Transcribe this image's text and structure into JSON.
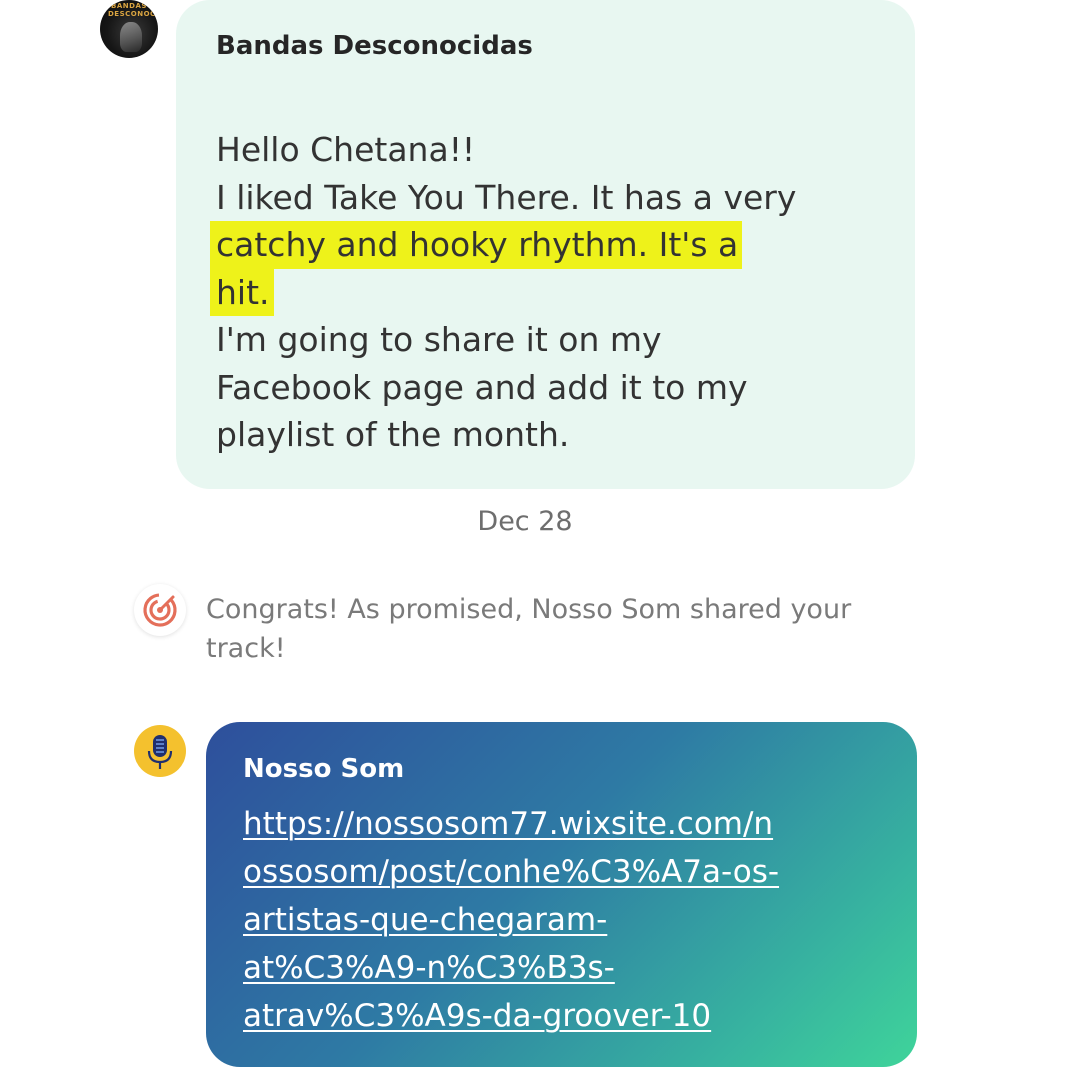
{
  "messages": [
    {
      "sender": "Bandas Desconocidas",
      "avatar_icon": "band-logo-avatar",
      "avatar_text": "BANDAS DESCONOCIDAS",
      "lines": [
        "Hello Chetana!!",
        "I liked Take You There. It has a very",
        "catchy and hooky rhythm. It's a",
        "hit.",
        "I'm going to share it on my",
        "Facebook page and add it to my",
        "playlist of the month."
      ],
      "highlighted_lines": [
        2,
        3
      ],
      "highlight_color": "#eef21a",
      "bubble_color": "#e8f7f1"
    },
    {
      "sender": "Nosso Som",
      "avatar_icon": "microphone-icon",
      "link_lines": [
        "https://nossosom77.wixsite.com/n",
        "ossosom/post/conhe%C3%A7a-os-",
        "artistas-que-chegaram-",
        "at%C3%A9-n%C3%B3s-",
        "atrav%C3%A9s-da-groover-10"
      ],
      "gradient": [
        "#2e4f9c",
        "#3fd49a"
      ]
    }
  ],
  "date_separator": "Dec 28",
  "system_message": {
    "icon": "target-icon",
    "icon_color": "#e46f5a",
    "lines": [
      "Congrats! As promised, Nosso Som shared your",
      "track!"
    ]
  }
}
